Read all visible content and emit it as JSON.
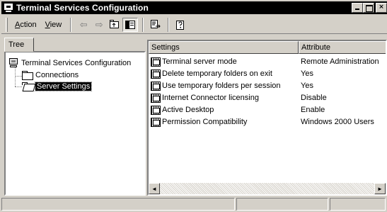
{
  "window": {
    "title": "Terminal Services Configuration",
    "close_glyph": "×"
  },
  "menu": {
    "action": {
      "mnemonic": "A",
      "rest": "ction"
    },
    "view": {
      "mnemonic": "V",
      "rest": "iew"
    }
  },
  "toolbar": {
    "back_glyph": "⇦",
    "forward_glyph": "⇨",
    "icons": [
      "back-arrow-icon",
      "forward-arrow-icon",
      "up-one-level-icon",
      "show-hide-tree-icon",
      "export-list-icon",
      "help-icon"
    ]
  },
  "tree": {
    "tab_label": "Tree",
    "root": "Terminal Services Configuration",
    "children": [
      "Connections",
      "Server Settings"
    ],
    "selected": "Server Settings"
  },
  "list": {
    "columns": [
      "Settings",
      "Attribute"
    ],
    "rows": [
      {
        "setting": "Terminal server mode",
        "attribute": "Remote Administration"
      },
      {
        "setting": "Delete temporary folders on exit",
        "attribute": "Yes"
      },
      {
        "setting": "Use temporary folders per session",
        "attribute": "Yes"
      },
      {
        "setting": "Internet Connector licensing",
        "attribute": "Disable"
      },
      {
        "setting": "Active Desktop",
        "attribute": "Enable"
      },
      {
        "setting": "Permission Compatibility",
        "attribute": "Windows 2000 Users"
      }
    ],
    "scroll_left": "◄",
    "scroll_right": "►"
  }
}
